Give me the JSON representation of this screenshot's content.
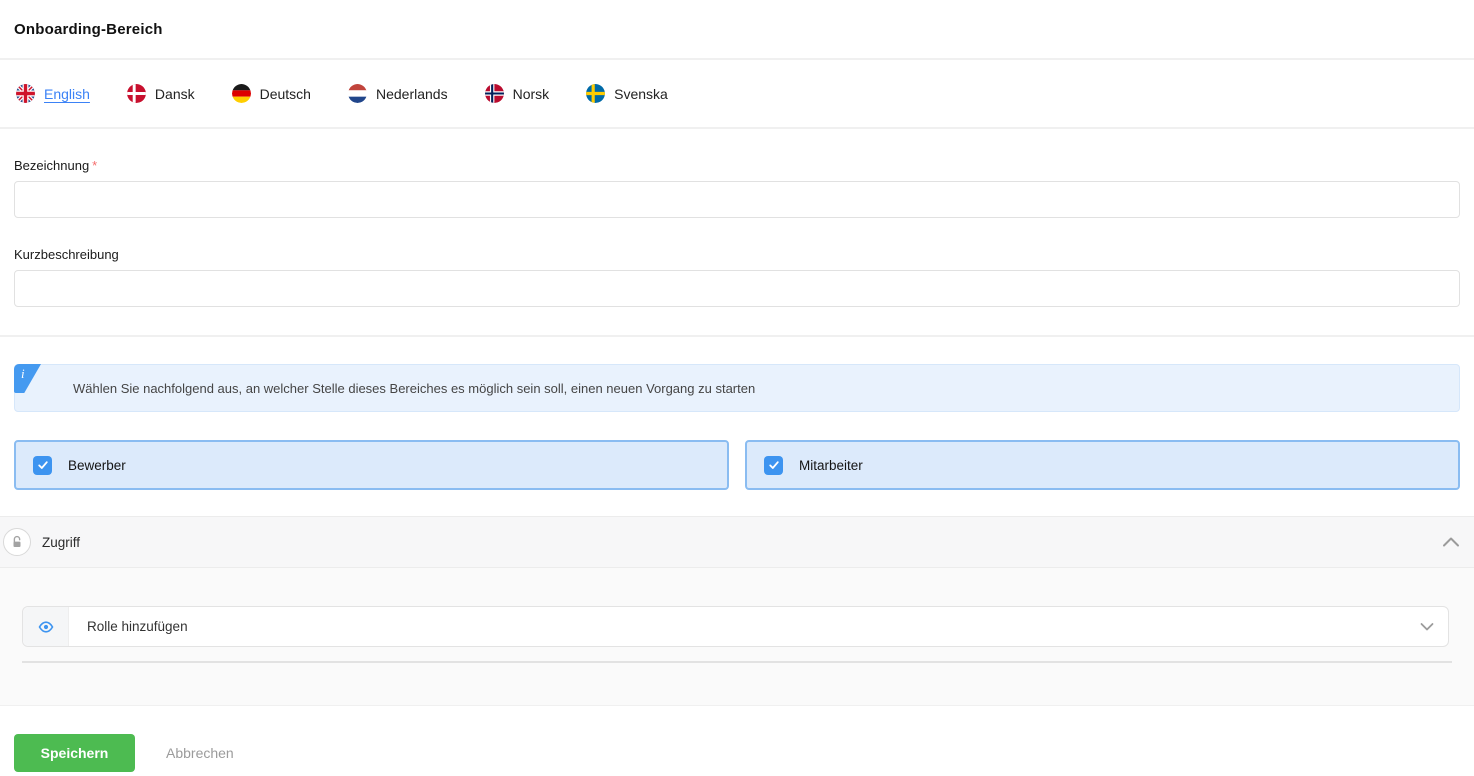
{
  "page": {
    "title": "Onboarding-Bereich"
  },
  "languages": {
    "items": [
      {
        "label": "English",
        "flag_icon": "flag-uk-icon",
        "active": true
      },
      {
        "label": "Dansk",
        "flag_icon": "flag-denmark-icon",
        "active": false
      },
      {
        "label": "Deutsch",
        "flag_icon": "flag-germany-icon",
        "active": false
      },
      {
        "label": "Nederlands",
        "flag_icon": "flag-netherlands-icon",
        "active": false
      },
      {
        "label": "Norsk",
        "flag_icon": "flag-norway-icon",
        "active": false
      },
      {
        "label": "Svenska",
        "flag_icon": "flag-sweden-icon",
        "active": false
      }
    ]
  },
  "form": {
    "name_label": "Bezeichnung",
    "required_marker": "*",
    "name_value": "",
    "description_label": "Kurzbeschreibung",
    "description_value": ""
  },
  "info_banner": {
    "icon_glyph": "i",
    "text": "Wählen Sie nachfolgend aus, an welcher Stelle dieses Bereiches es möglich sein soll, einen neuen Vorgang zu starten"
  },
  "start_options": {
    "items": [
      {
        "label": "Bewerber",
        "checked": true
      },
      {
        "label": "Mitarbeiter",
        "checked": true
      }
    ]
  },
  "access_section": {
    "title": "Zugriff",
    "collapse_state": "expanded"
  },
  "role_select": {
    "placeholder": "Rolle hinzufügen"
  },
  "footer": {
    "save_label": "Speichern",
    "cancel_label": "Abbrechen"
  },
  "colors": {
    "accent_blue": "#3d94f0",
    "banner_badge_blue": "#459af0",
    "banner_bg": "#e9f2fd",
    "card_bg": "#dceafb",
    "card_border": "#8abcf1",
    "save_green": "#4dbb51",
    "required_red": "#f56c6c"
  }
}
